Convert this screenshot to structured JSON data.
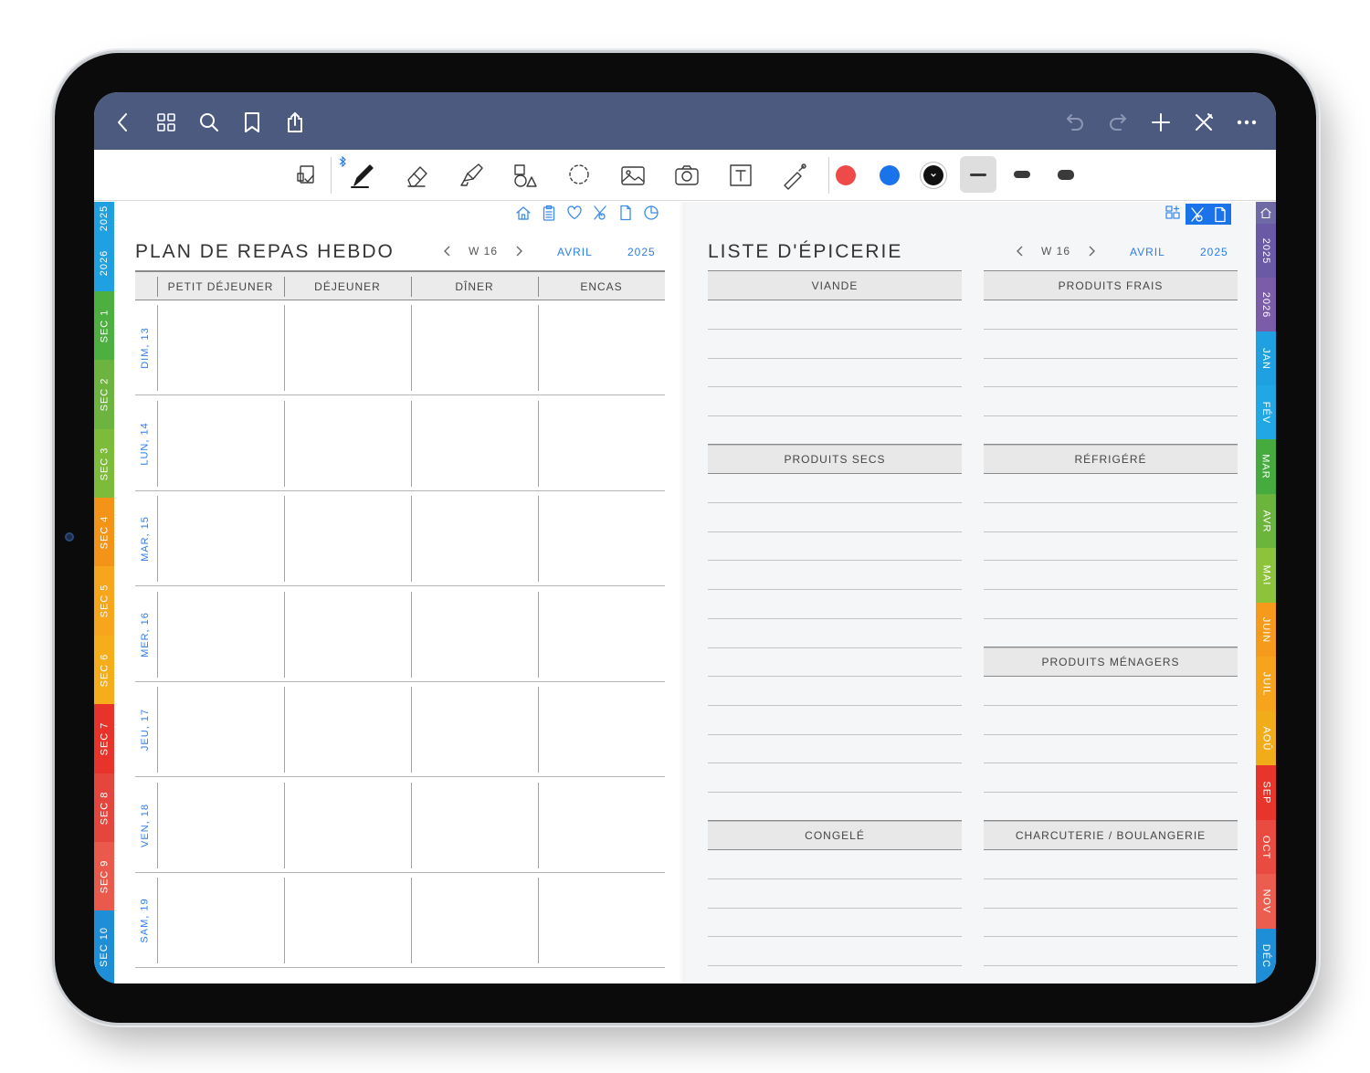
{
  "nav": {
    "left_icons": [
      "back-icon",
      "grid-icon",
      "search-icon",
      "bookmark-icon",
      "share-icon"
    ],
    "right_icons": [
      "undo-icon",
      "redo-icon",
      "plus-icon",
      "close-pen-icon",
      "more-icon"
    ]
  },
  "toolbar": {
    "tools": [
      "read-only-icon",
      "pen-icon",
      "eraser-icon",
      "highlighter-icon",
      "shapes-icon",
      "lasso-icon",
      "image-icon",
      "camera-icon",
      "text-icon",
      "laser-pointer-icon"
    ],
    "colors": [
      "#ef4a4a",
      "#1a73e8",
      "#111111"
    ],
    "selected_color": "#111111",
    "stroke_widths": [
      "thin",
      "medium",
      "thick"
    ],
    "selected_stroke": "thin"
  },
  "left_tabs": [
    {
      "label": "2025",
      "color": "#1fa0e0"
    },
    {
      "label": "2026",
      "color": "#1fa0e0"
    },
    {
      "label": "SEC 1",
      "color": "#4caf3f"
    },
    {
      "label": "SEC 2",
      "color": "#6db33f"
    },
    {
      "label": "SEC 3",
      "color": "#7dbb3a"
    },
    {
      "label": "SEC 4",
      "color": "#f39419"
    },
    {
      "label": "SEC 5",
      "color": "#f7a51c"
    },
    {
      "label": "SEC 6",
      "color": "#f6ad1b"
    },
    {
      "label": "SEC 7",
      "color": "#e8332a"
    },
    {
      "label": "SEC 8",
      "color": "#e4463d"
    },
    {
      "label": "SEC 9",
      "color": "#ea5a4c"
    },
    {
      "label": "SEC 10",
      "color": "#1e8fd6"
    }
  ],
  "right_tabs": [
    {
      "label": "",
      "icon": "home-icon",
      "color": "#6f6aa6"
    },
    {
      "label": "2025",
      "color": "#6a5aa5"
    },
    {
      "label": "2026",
      "color": "#7b5ca8"
    },
    {
      "label": "JAN",
      "color": "#1fa0e0"
    },
    {
      "label": "FÉV",
      "color": "#21a8e4"
    },
    {
      "label": "MAR",
      "color": "#45ab3e"
    },
    {
      "label": "AVR",
      "color": "#6cb53c"
    },
    {
      "label": "MAI",
      "color": "#8dc23b"
    },
    {
      "label": "JUIN",
      "color": "#f59a1a"
    },
    {
      "label": "JUIL",
      "color": "#f5a41b"
    },
    {
      "label": "AOÛ",
      "color": "#f1ac19"
    },
    {
      "label": "SEP",
      "color": "#e7352b"
    },
    {
      "label": "OCT",
      "color": "#e94b40"
    },
    {
      "label": "NOV",
      "color": "#eb5d4e"
    },
    {
      "label": "DÉC",
      "color": "#1e8fd6"
    }
  ],
  "left_page": {
    "mini_icons": [
      "home-icon",
      "clipboard-icon",
      "heart-icon",
      "cutlery-icon",
      "document-icon",
      "pie-chart-icon"
    ],
    "title": "PLAN DE REPAS HEBDO",
    "week": "W 16",
    "month": "AVRIL",
    "year": "2025",
    "columns": [
      "PETIT DÉJEUNER",
      "DÉJEUNER",
      "DÎNER",
      "ENCAS"
    ],
    "days": [
      "DIM, 13",
      "LUN, 14",
      "MAR, 15",
      "MER, 16",
      "JEU, 17",
      "VEN, 18",
      "SAM, 19"
    ]
  },
  "right_page": {
    "mini_icons": [
      "grid-plus-icon",
      "cutlery-icon",
      "document-icon"
    ],
    "active_icons": [
      "cutlery-icon",
      "document-icon"
    ],
    "title": "LISTE D'ÉPICERIE",
    "week": "W 16",
    "month": "AVRIL",
    "year": "2025",
    "sections": {
      "viande": "VIANDE",
      "produits_frais": "PRODUITS FRAIS",
      "produits_secs": "PRODUITS SECS",
      "refrigere": "RÉFRIGÉRÉ",
      "produits_menagers": "PRODUITS MÉNAGERS",
      "congele": "CONGELÉ",
      "charcuterie": "CHARCUTERIE / BOULANGERIE"
    }
  }
}
